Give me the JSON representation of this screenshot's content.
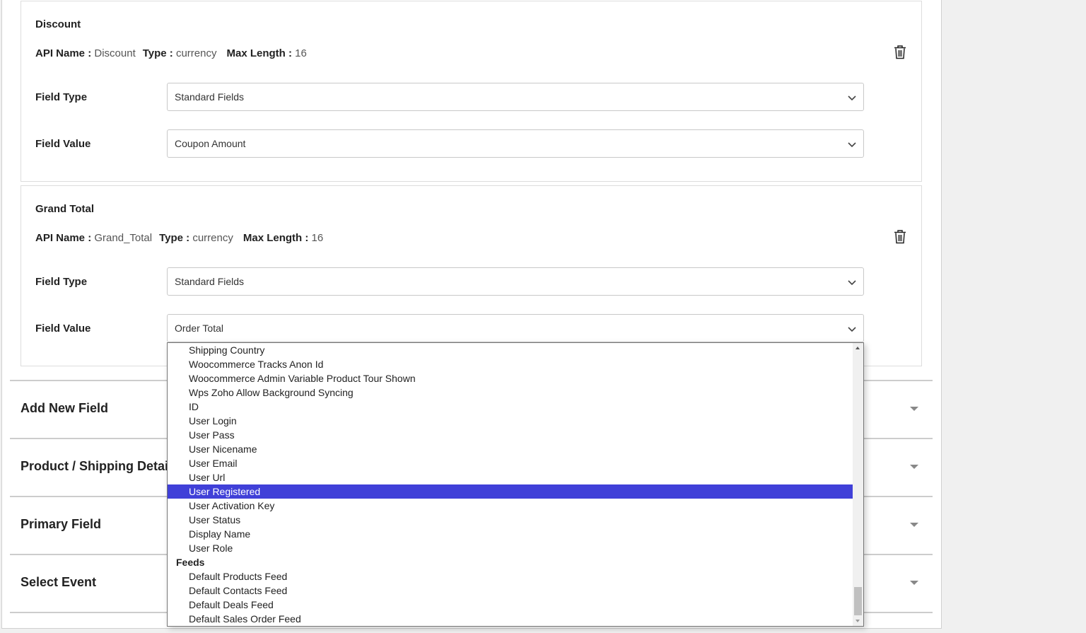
{
  "cards": [
    {
      "title": "Discount",
      "api_label": "API Name :",
      "api": "Discount",
      "type_label": "Type :",
      "type": "currency",
      "max_label": "Max Length :",
      "max": "16",
      "field_type_label": "Field Type",
      "field_type": "Standard Fields",
      "field_value_label": "Field Value",
      "field_value": "Coupon Amount"
    },
    {
      "title": "Grand Total",
      "api_label": "API Name :",
      "api": "Grand_Total",
      "type_label": "Type :",
      "type": "currency",
      "max_label": "Max Length :",
      "max": "16",
      "field_type_label": "Field Type",
      "field_type": "Standard Fields",
      "field_value_label": "Field Value",
      "field_value": "Order Total"
    }
  ],
  "accordions": [
    "Add New Field",
    "Product / Shipping Details",
    "Primary Field",
    "Select Event"
  ],
  "dropdown": {
    "options": [
      {
        "label": "Shipping Country"
      },
      {
        "label": "Woocommerce Tracks Anon Id"
      },
      {
        "label": "Woocommerce Admin Variable Product Tour Shown"
      },
      {
        "label": "Wps Zoho Allow Background Syncing"
      },
      {
        "label": "ID"
      },
      {
        "label": "User Login"
      },
      {
        "label": "User Pass"
      },
      {
        "label": "User Nicename"
      },
      {
        "label": "User Email"
      },
      {
        "label": "User Url"
      },
      {
        "label": "User Registered",
        "selected": true
      },
      {
        "label": "User Activation Key"
      },
      {
        "label": "User Status"
      },
      {
        "label": "Display Name"
      },
      {
        "label": "User Role"
      },
      {
        "label": "Feeds",
        "group": true
      },
      {
        "label": "Default Products Feed"
      },
      {
        "label": "Default Contacts Feed"
      },
      {
        "label": "Default Deals Feed"
      },
      {
        "label": "Default Sales Order Feed"
      }
    ]
  },
  "colors": {
    "highlight": "#4040d8"
  }
}
